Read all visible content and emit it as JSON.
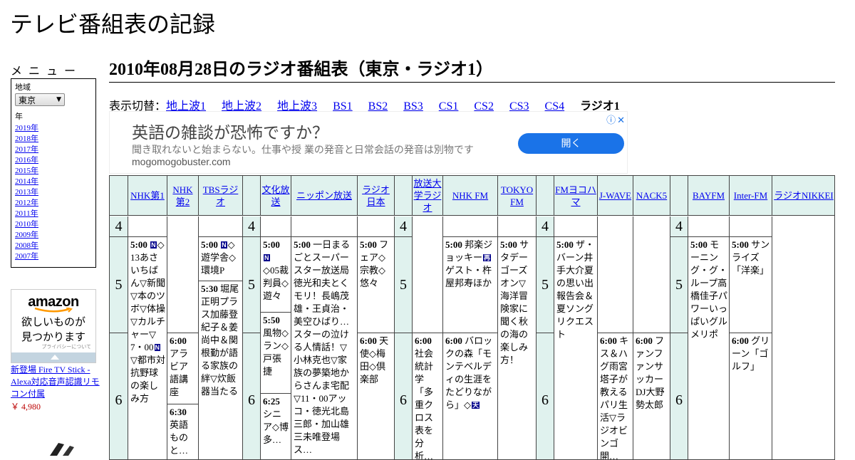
{
  "site_title": "テレビ番組表の記録",
  "menu": {
    "heading": "メニュー",
    "region_label": "地域",
    "region_value": "東京",
    "year_label": "年",
    "years": [
      "2019年",
      "2018年",
      "2017年",
      "2016年",
      "2015年",
      "2014年",
      "2013年",
      "2012年",
      "2011年",
      "2010年",
      "2009年",
      "2008年",
      "2007年"
    ]
  },
  "amazon_ad": {
    "logo": "amazon",
    "tagline_1": "欲しいものが",
    "tagline_2": "見つかります",
    "privacy": "プライバシーについて",
    "product_link": "新登場 Fire TV Stick - Alexa対応音声認識リモコン付属",
    "price": "￥ 4,980"
  },
  "page_title": "2010年08月28日のラジオ番組表（東京・ラジオ1）",
  "switcher": {
    "prefix": "表示切替：",
    "links": [
      "地上波1",
      "地上波2",
      "地上波3",
      "BS1",
      "BS2",
      "BS3",
      "CS1",
      "CS2",
      "CS3",
      "CS4"
    ],
    "current": "ラジオ1"
  },
  "google_ad": {
    "title": "英語の雑談が恐怖ですか？",
    "description": "聞き取れないと始まらない。仕事や授 業の発音と日常会話の発音は別物です",
    "domain": "mogomogobuster.com",
    "button": "開く",
    "info_icon": "ⓘ",
    "close_icon": "✕"
  },
  "tags": {
    "news": "N",
    "rerun": "再",
    "weather": "天"
  },
  "channels": [
    "NHK第1",
    "NHK第2",
    "TBSラジオ",
    "文化放送",
    "ニッポン放送",
    "ラジオ日本",
    "放送大学ラジオ",
    "NHK FM",
    "TOKYO FM",
    "FMヨコハマ",
    "J-WAVE",
    "NACK5",
    "BAYFM",
    "Inter-FM",
    "ラジオNIKKEI"
  ],
  "hours": {
    "h4": "4",
    "h5": "5",
    "h6": "6"
  },
  "programs": {
    "nhk1_500_time": "5:00",
    "nhk1_500_text": "◇13あさいちばん▽新聞▽本のツボ▽体操▽カルチャー▽7・00",
    "nhk1_500_text2": "▽都市対抗野球の楽しみ方",
    "nhk2_600_time": "6:00",
    "nhk2_600_text": "アラビア語講座",
    "nhk2_630_time": "6:30",
    "nhk2_630_text": "英語ものと…",
    "tbs_500_time": "5:00",
    "tbs_500_text": "◇遊学舎◇環境P",
    "tbs_530_time": "5:30",
    "tbs_530_text": "堀尾正明プラス加藤登紀子＆姜尚中＆関根勤が語る家族の絆▽炊飯器当たる",
    "qr_500_time": "5:00",
    "qr_500_text": "◇05裁判員◇遊々",
    "qr_550_time": "5:50",
    "qr_550_text": "風物◇ラン◇戸張捷",
    "qr_625_time": "6:25",
    "qr_625_text": "シニア◇博多…",
    "lf_500_time": "5:00",
    "lf_500_text": "一日まるごとスーパースター放送局徳光和夫とくモリ！長嶋茂雄・王貞治・美空ひばり…スターの泣ける人情話！▽小林克也▽家族の夢築地からさんま宅配▽11・00アッコ・徳光北島三郎・加山雄三未唯登場ス…",
    "jora_500_time": "5:00",
    "jora_500_text": "フェア◇宗教◇悠々",
    "jora_600_time": "6:00",
    "jora_600_text": "天使◇梅田◇倶楽部",
    "ouj_600_time": "6:00",
    "ouj_600_text": "社会統計学「多重クロス表を分析…",
    "nhkfm_500_time": "5:00",
    "nhkfm_500_text": "邦楽ジョッキー",
    "nhkfm_500_text2": "ゲスト・杵屋邦寿ほか",
    "nhkfm_600_time": "6:00",
    "nhkfm_600_text": "バロックの森「モンテベルディの生涯をたどりながら」◇",
    "tfm_500_time": "5:00",
    "tfm_500_text": "サタデーゴーズオン▽海洋冒険家に聞く秋の海の楽しみ方！",
    "fmy_500_time": "5:00",
    "fmy_500_text": "ザ・バーン井手大介夏の思い出報告会＆夏ソングリクエスト",
    "jwave_600_time": "6:00",
    "jwave_600_text": "キス＆ハグ雨宮塔子が教えるパリ生活▽ラジオビンゴ開…",
    "nack5_600_time": "6:00",
    "nack5_600_text": "ファンファンサッカーDJ大野勢太郎",
    "bay_500_time": "5:00",
    "bay_500_text": "モーニング・グ・ループ高橋佳子パワーいっぱいグルメリポ",
    "inter_500_time": "5:00",
    "inter_500_text": "サンライズ「洋楽」",
    "inter_600_time": "6:00",
    "inter_600_text": "グリーン「ゴルフ」"
  }
}
